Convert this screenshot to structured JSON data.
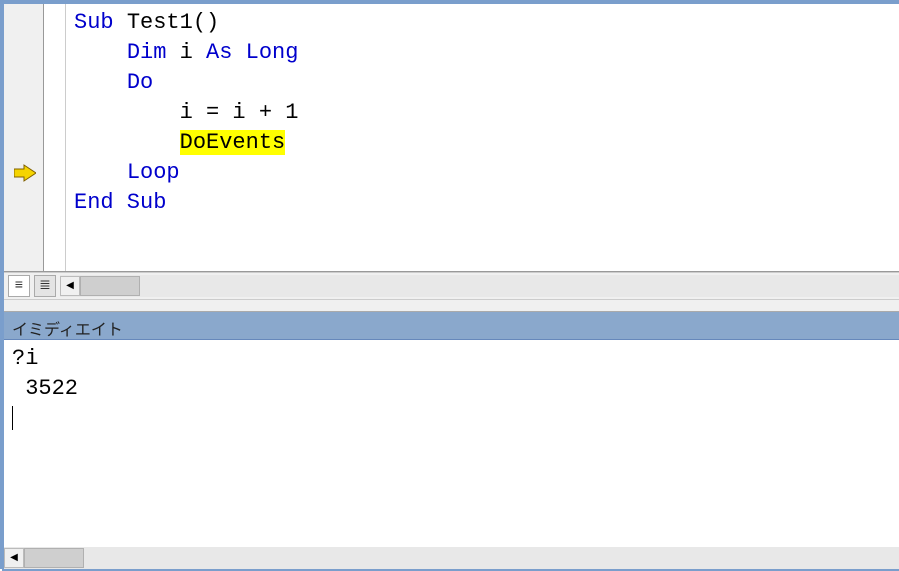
{
  "code": {
    "lines": [
      {
        "indent": "",
        "tokens": [
          {
            "t": "Sub ",
            "cls": "kw"
          },
          {
            "t": "Test1()",
            "cls": "plain"
          }
        ]
      },
      {
        "indent": "    ",
        "tokens": [
          {
            "t": "Dim ",
            "cls": "kw"
          },
          {
            "t": "i ",
            "cls": "plain"
          },
          {
            "t": "As Long",
            "cls": "kw"
          }
        ]
      },
      {
        "indent": "",
        "tokens": [
          {
            "t": "",
            "cls": "plain"
          }
        ]
      },
      {
        "indent": "    ",
        "tokens": [
          {
            "t": "Do",
            "cls": "kw"
          }
        ]
      },
      {
        "indent": "        ",
        "tokens": [
          {
            "t": "i = i + 1",
            "cls": "plain"
          }
        ]
      },
      {
        "indent": "        ",
        "tokens": [
          {
            "t": "DoEvents",
            "cls": "plain",
            "hl": true
          }
        ]
      },
      {
        "indent": "    ",
        "tokens": [
          {
            "t": "Loop",
            "cls": "kw"
          }
        ]
      },
      {
        "indent": "",
        "tokens": [
          {
            "t": "",
            "cls": "plain"
          }
        ]
      },
      {
        "indent": "",
        "tokens": [
          {
            "t": "End Sub",
            "cls": "kw"
          }
        ]
      }
    ],
    "current_line_index": 5
  },
  "toolbar": {
    "btn_proc_view": "≡",
    "btn_full_view": "≣"
  },
  "immediate": {
    "header": "イミディエイト",
    "lines": [
      "?i",
      " 3522",
      ""
    ]
  }
}
